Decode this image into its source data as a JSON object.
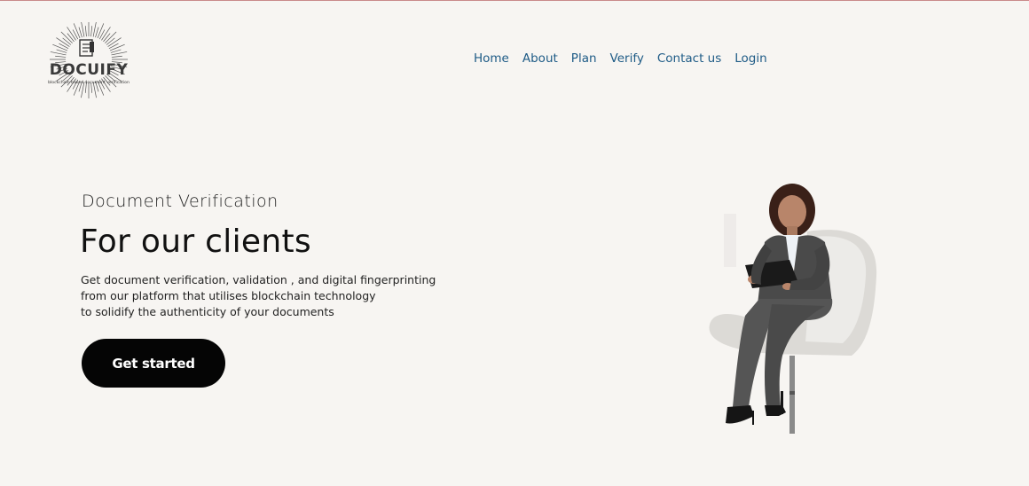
{
  "brand": {
    "name": "DOCUIFY",
    "tagline": "blockchain based document verification"
  },
  "nav": {
    "items": [
      {
        "label": "Home"
      },
      {
        "label": "About"
      },
      {
        "label": "Plan"
      },
      {
        "label": "Verify"
      },
      {
        "label": "Contact us"
      },
      {
        "label": "Login"
      }
    ]
  },
  "hero": {
    "subtitle": "Document Verification",
    "title": "For our clients",
    "description": [
      "Get document verification, validation , and digital fingerprinting",
      "from our platform that utilises blockchain technology",
      "to solidify the authenticity of your documents"
    ],
    "cta_label": "Get started",
    "image_subject": "businesswoman-seated-in-chair-with-clipboard"
  },
  "colors": {
    "background": "#f7f5f2",
    "nav_link": "#1e5b86",
    "cta_background": "#050505",
    "cta_text": "#ffffff",
    "top_border": "#c98a8a"
  }
}
